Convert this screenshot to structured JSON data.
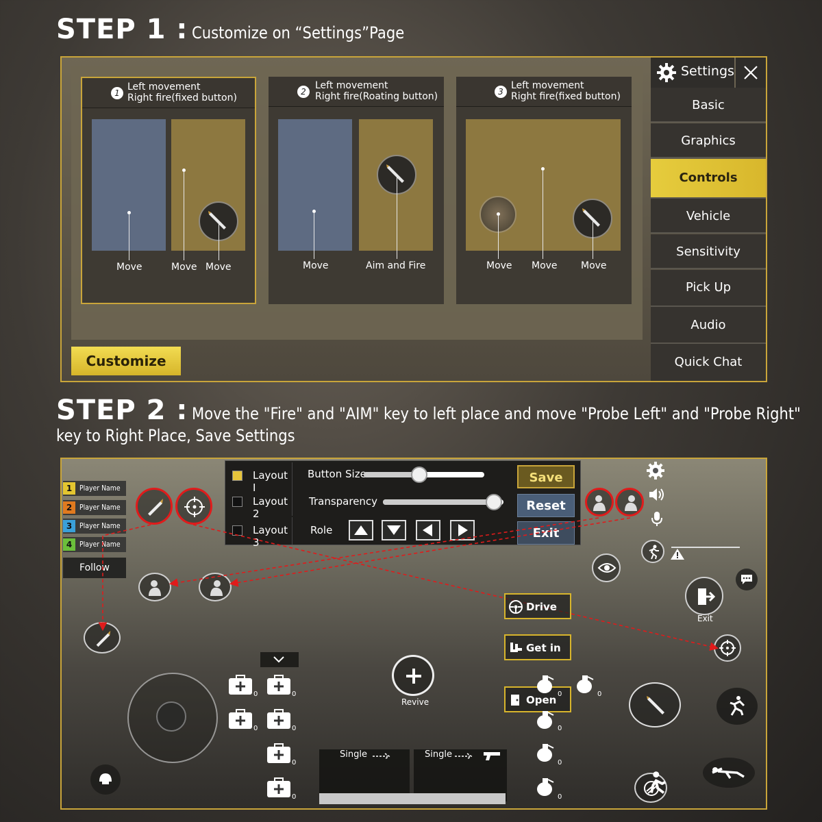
{
  "step1": {
    "prefix": "STEP 1 :",
    "title": "Customize on “Settings”Page",
    "layouts": [
      {
        "num": "1",
        "line1": "Left movement",
        "line2": "Right fire(fixed button)",
        "labels": [
          "Move",
          "Move",
          "Move"
        ]
      },
      {
        "num": "2",
        "line1": "Left movement",
        "line2": "Right fire(Roating button)",
        "labels": [
          "Move",
          "Aim and Fire"
        ]
      },
      {
        "num": "3",
        "line1": "Left movement",
        "line2": "Right fire(fixed button)",
        "labels": [
          "Move",
          "Move",
          "Move"
        ]
      }
    ],
    "customize_label": "Customize",
    "settings": {
      "title": "Settings",
      "items": [
        "Basic",
        "Graphics",
        "Controls",
        "Vehicle",
        "Sensitivity",
        "Pick Up",
        "Audio",
        "Quick Chat"
      ],
      "active": "Controls"
    }
  },
  "step2": {
    "prefix": "STEP 2 :",
    "line1": "Move the \"Fire\" and \"AIM\" key to left place and move \"Probe Left\" and \"Probe Right\"",
    "line2": "key to Right Place, Save Settings",
    "players": [
      {
        "num": "1",
        "name": "Player Name",
        "color": "#e3c530"
      },
      {
        "num": "2",
        "name": "Player Name",
        "color": "#e07a1f"
      },
      {
        "num": "3",
        "name": "Player Name",
        "color": "#3aa0d8"
      },
      {
        "num": "4",
        "name": "Player Name",
        "color": "#6bbf3b"
      }
    ],
    "follow": "Follow",
    "popup": {
      "layouts": [
        "Layout I",
        "Layout 2",
        "Layout 3"
      ],
      "button_size": "Button Size",
      "button_size_value": 0.46,
      "transparency": "Transparency",
      "transparency_value": 0.92,
      "role": "Role",
      "save": "Save",
      "reset": "Reset",
      "exit": "Exit"
    },
    "buttons": {
      "drive": "Drive",
      "get_in": "Get in",
      "open": "Open",
      "revive": "Revive",
      "exit": "Exit",
      "single1": "Single",
      "single2": "Single",
      "item_count": "0"
    },
    "colors": {
      "accent": "#c9a53a",
      "highlight": "#e01b1b"
    }
  }
}
